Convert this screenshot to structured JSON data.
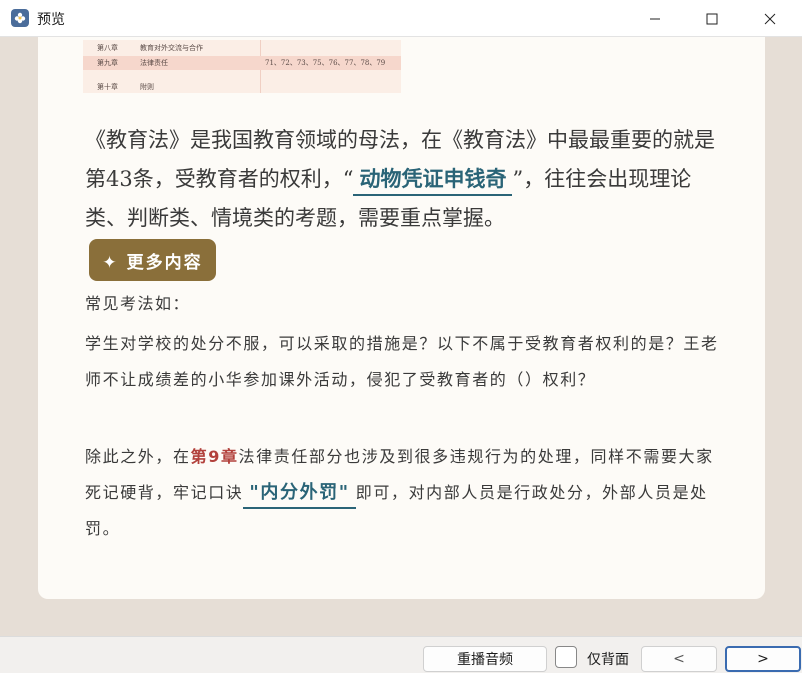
{
  "window": {
    "title": "预览",
    "app_icon": "flower-app-icon",
    "controls": [
      "minimize-icon",
      "maximize-icon",
      "close-icon"
    ]
  },
  "table_image": {
    "rows": [
      {
        "chapter": "第八章",
        "title": "教育对外交流与合作",
        "articles": ""
      },
      {
        "chapter": "第九章",
        "title": "法律责任",
        "articles": "71、72、73、75、76、77、78、79"
      },
      {
        "chapter": "第十章",
        "title": "附则",
        "articles": ""
      }
    ]
  },
  "content": {
    "p1_before": "《教育法》是我国教育领域的母法，在《教育法》中最最重要的就是第43条，受教育者的权利，“",
    "p1_highlight": "动物凭证申钱奇",
    "p1_after": "”，往往会出现理论类、判断类、情境类的考题，需要重点掌握。",
    "more_button": "✦ 更多内容",
    "p2": "常见考法如：",
    "p3": "学生对学校的处分不服，可以采取的措施是？以下不属于受教育者权利的是？王老师不让成绩差的小华参加课外活动，侵犯了受教育者的（）权利？",
    "p4_before": "除此之外，在",
    "p4_chapter": "第9章",
    "p4_middle": "法律责任部分也涉及到很多违规行为的处理，同样不需要大家死记硬背，牢记口诀",
    "p4_highlight": "\"内分外罚\"",
    "p4_after": "即可，对内部人员是行政处分，外部人员是处罚。"
  },
  "bottom": {
    "replay_button": "重播音频",
    "back_only_label": "仅背面",
    "prev_button": "<",
    "next_button": ">"
  },
  "colors": {
    "highlight": "#2a6477",
    "chapter_red": "#b2413c",
    "more_button_bg": "#8a6f3a",
    "card_bg": "#fdfbf7",
    "page_bg": "#e6ded6"
  }
}
